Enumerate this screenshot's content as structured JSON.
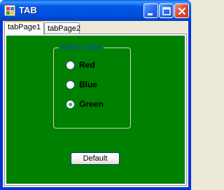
{
  "window": {
    "title": "TAB",
    "controls": {
      "minimize_icon": "minimize-icon",
      "maximize_icon": "maximize-icon",
      "close_icon": "close-icon"
    }
  },
  "tabs": [
    {
      "label": "tabPage1",
      "selected": true
    },
    {
      "label": "tabPage2",
      "selected": false
    }
  ],
  "group": {
    "title": "Select Color",
    "options": [
      {
        "label": "Red",
        "checked": false
      },
      {
        "label": "Blue",
        "checked": false
      },
      {
        "label": "Green",
        "checked": true
      }
    ]
  },
  "default_button": {
    "label": "Default"
  },
  "colors": {
    "page_background": "#008000",
    "group_title": "#0046d5",
    "titlebar": "#0054e3"
  }
}
